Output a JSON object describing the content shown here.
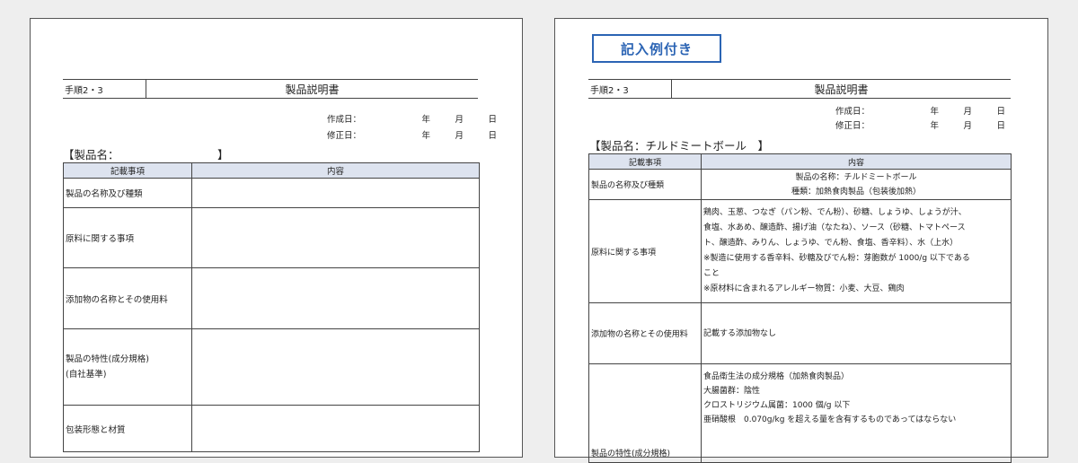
{
  "left": {
    "step": "手順2・3",
    "title": "製品説明書",
    "date_created_label": "作成日：",
    "date_revised_label": "修正日：",
    "year": "年",
    "month": "月",
    "day": "日",
    "product_name_label": "【製品名：",
    "product_name_close": "】",
    "col_item": "記載事項",
    "col_content": "内容",
    "rows": [
      "製品の名称及び種類",
      "原料に関する事項",
      "添加物の名称とその使用料",
      "製品の特性(成分規格)",
      "(自社基準)",
      "包装形態と材質"
    ]
  },
  "right": {
    "badge": "記入例付き",
    "step": "手順2・3",
    "title": "製品説明書",
    "date_created_label": "作成日：",
    "date_revised_label": "修正日：",
    "year": "年",
    "month": "月",
    "day": "日",
    "product_name_label": "【製品名：チルドミートボール　】",
    "col_item": "記載事項",
    "col_content": "内容",
    "row1_key": "製品の名称及び種類",
    "row1_line1": "製品の名称：チルドミートボール",
    "row1_line2": "種類：加熱食肉製品（包装後加熱）",
    "row2_key": "原料に関する事項",
    "row2_lines": [
      "鶏肉、玉葱、つなぎ（パン粉、でん粉）、砂糖、しょうゆ、しょうが汁、",
      "食塩、水あめ、醸造酢、揚げ油（なたね）、ソース（砂糖、トマトペース",
      "ト、醸造酢、みりん、しょうゆ、でん粉、食塩、香辛料）、水（上水）",
      "※製造に使用する香辛料、砂糖及びでん粉：芽胞数が 1000/g 以下である",
      "こと",
      "※原材料に含まれるアレルギー物質：小麦、大豆、鶏肉"
    ],
    "row3_key": "添加物の名称とその使用料",
    "row3_value": "記載する添加物なし",
    "row4_key": "製品の特性(成分規格)",
    "row4_lines": [
      "食品衛生法の成分規格（加熱食肉製品）",
      "大腸菌群：陰性",
      "クロストリジウム属菌：1000 個/g 以下",
      "亜硝酸根　0.070g/kg を超える量を含有するものであってはならない"
    ]
  }
}
